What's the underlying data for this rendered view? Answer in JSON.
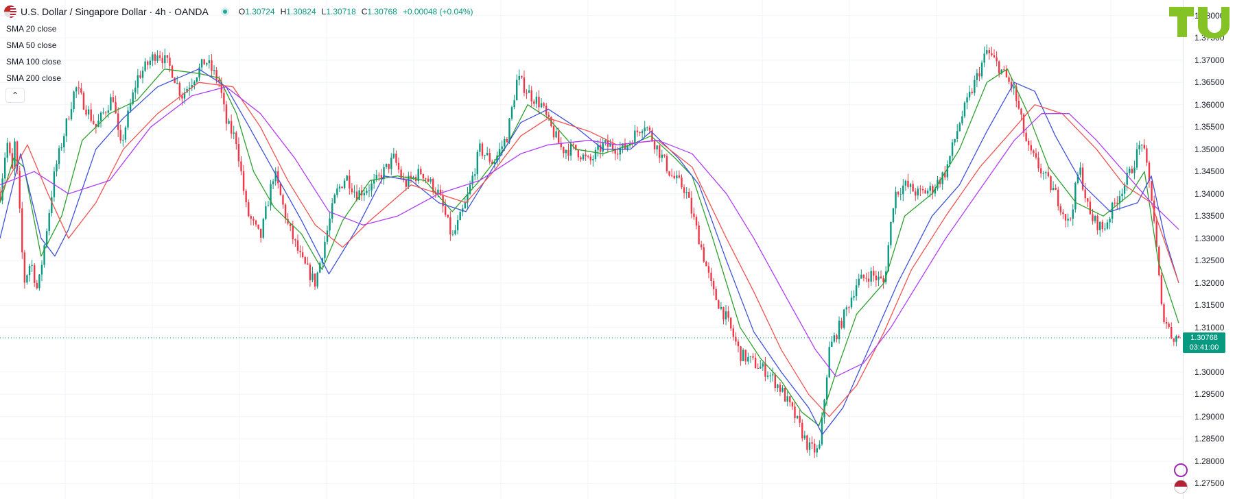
{
  "header": {
    "symbol_title": "U.S. Dollar / Singapore Dollar · 4h · OANDA",
    "o_key": "O",
    "o_val": "1.30724",
    "h_key": "H",
    "h_val": "1.30824",
    "l_key": "L",
    "l_val": "1.30718",
    "c_key": "C",
    "c_val": "1.30768",
    "change": "+0.00048 (+0.04%)"
  },
  "indicators": [
    {
      "label": "SMA",
      "value": "20 close",
      "color": "#2ca02c"
    },
    {
      "label": "SMA",
      "value": "50 close",
      "color": "#3f51d9"
    },
    {
      "label": "SMA",
      "value": "100 close",
      "color": "#ef5350"
    },
    {
      "label": "SMA",
      "value": "200 close",
      "color": "#b03cf5"
    }
  ],
  "price_axis_ticks": [
    "1.38000",
    "1.37500",
    "1.37000",
    "1.36500",
    "1.36000",
    "1.35500",
    "1.35000",
    "1.34500",
    "1.34000",
    "1.33500",
    "1.33000",
    "1.32500",
    "1.32000",
    "1.31500",
    "1.31000",
    "1.30000",
    "1.29500",
    "1.29000",
    "1.28500",
    "1.28000",
    "1.27500"
  ],
  "current_price": {
    "price": "1.30768",
    "countdown": "03:41:00"
  },
  "colors": {
    "up": "#089981",
    "down": "#f23645",
    "grid": "#f0f3fa",
    "accent": "#089981",
    "logo": "#84c225"
  },
  "chart_data": {
    "type": "line",
    "ylim": [
      1.2715,
      1.3835
    ],
    "price_line": 1.30768,
    "candles_n": 480,
    "price_path": [
      [
        0,
        1.34
      ],
      [
        10,
        1.352
      ],
      [
        18,
        1.345
      ],
      [
        22,
        1.352
      ],
      [
        35,
        1.32
      ],
      [
        45,
        1.325
      ],
      [
        55,
        1.318
      ],
      [
        80,
        1.345
      ],
      [
        110,
        1.364
      ],
      [
        140,
        1.355
      ],
      [
        165,
        1.362
      ],
      [
        175,
        1.35
      ],
      [
        200,
        1.366
      ],
      [
        230,
        1.372
      ],
      [
        250,
        1.368
      ],
      [
        265,
        1.362
      ],
      [
        300,
        1.37
      ],
      [
        320,
        1.365
      ],
      [
        330,
        1.356
      ],
      [
        345,
        1.352
      ],
      [
        360,
        1.336
      ],
      [
        380,
        1.33
      ],
      [
        400,
        1.345
      ],
      [
        420,
        1.333
      ],
      [
        440,
        1.325
      ],
      [
        460,
        1.32
      ],
      [
        475,
        1.33
      ],
      [
        490,
        1.34
      ],
      [
        505,
        1.344
      ],
      [
        520,
        1.34
      ],
      [
        545,
        1.342
      ],
      [
        560,
        1.345
      ],
      [
        575,
        1.348
      ],
      [
        590,
        1.342
      ],
      [
        615,
        1.345
      ],
      [
        640,
        1.34
      ],
      [
        660,
        1.33
      ],
      [
        680,
        1.338
      ],
      [
        700,
        1.35
      ],
      [
        720,
        1.347
      ],
      [
        740,
        1.353
      ],
      [
        755,
        1.366
      ],
      [
        775,
        1.362
      ],
      [
        790,
        1.36
      ],
      [
        800,
        1.356
      ],
      [
        820,
        1.35
      ],
      [
        840,
        1.35
      ],
      [
        860,
        1.347
      ],
      [
        880,
        1.351
      ],
      [
        910,
        1.35
      ],
      [
        940,
        1.356
      ],
      [
        960,
        1.35
      ],
      [
        980,
        1.344
      ],
      [
        1000,
        1.341
      ],
      [
        1020,
        1.33
      ],
      [
        1040,
        1.318
      ],
      [
        1060,
        1.312
      ],
      [
        1080,
        1.304
      ],
      [
        1100,
        1.302
      ],
      [
        1120,
        1.3
      ],
      [
        1140,
        1.296
      ],
      [
        1160,
        1.29
      ],
      [
        1180,
        1.283
      ],
      [
        1195,
        1.282
      ],
      [
        1210,
        1.305
      ],
      [
        1230,
        1.312
      ],
      [
        1250,
        1.32
      ],
      [
        1270,
        1.322
      ],
      [
        1290,
        1.32
      ],
      [
        1305,
        1.34
      ],
      [
        1320,
        1.342
      ],
      [
        1340,
        1.34
      ],
      [
        1360,
        1.341
      ],
      [
        1380,
        1.345
      ],
      [
        1400,
        1.356
      ],
      [
        1420,
        1.364
      ],
      [
        1440,
        1.372
      ],
      [
        1460,
        1.368
      ],
      [
        1480,
        1.363
      ],
      [
        1500,
        1.35
      ],
      [
        1520,
        1.345
      ],
      [
        1540,
        1.34
      ],
      [
        1560,
        1.333
      ],
      [
        1575,
        1.346
      ],
      [
        1590,
        1.335
      ],
      [
        1610,
        1.332
      ],
      [
        1630,
        1.339
      ],
      [
        1650,
        1.345
      ],
      [
        1666,
        1.352
      ],
      [
        1682,
        1.338
      ],
      [
        1695,
        1.314
      ],
      [
        1710,
        1.308
      ],
      [
        1720,
        1.3077
      ]
    ],
    "series": [
      {
        "name": "SMA 20 close",
        "color": "#2ca02c",
        "points": [
          [
            0,
            1.338
          ],
          [
            20,
            1.348
          ],
          [
            35,
            1.346
          ],
          [
            60,
            1.326
          ],
          [
            90,
            1.335
          ],
          [
            120,
            1.352
          ],
          [
            160,
            1.358
          ],
          [
            200,
            1.361
          ],
          [
            240,
            1.368
          ],
          [
            290,
            1.367
          ],
          [
            320,
            1.366
          ],
          [
            345,
            1.358
          ],
          [
            370,
            1.345
          ],
          [
            400,
            1.337
          ],
          [
            440,
            1.331
          ],
          [
            470,
            1.323
          ],
          [
            500,
            1.334
          ],
          [
            540,
            1.343
          ],
          [
            580,
            1.344
          ],
          [
            620,
            1.343
          ],
          [
            660,
            1.336
          ],
          [
            700,
            1.343
          ],
          [
            740,
            1.351
          ],
          [
            770,
            1.36
          ],
          [
            800,
            1.357
          ],
          [
            840,
            1.35
          ],
          [
            880,
            1.349
          ],
          [
            920,
            1.351
          ],
          [
            950,
            1.353
          ],
          [
            985,
            1.348
          ],
          [
            1010,
            1.344
          ],
          [
            1040,
            1.33
          ],
          [
            1080,
            1.31
          ],
          [
            1110,
            1.303
          ],
          [
            1140,
            1.298
          ],
          [
            1170,
            1.291
          ],
          [
            1195,
            1.288
          ],
          [
            1220,
            1.3
          ],
          [
            1250,
            1.313
          ],
          [
            1290,
            1.32
          ],
          [
            1320,
            1.335
          ],
          [
            1360,
            1.34
          ],
          [
            1400,
            1.35
          ],
          [
            1440,
            1.365
          ],
          [
            1470,
            1.368
          ],
          [
            1500,
            1.358
          ],
          [
            1530,
            1.346
          ],
          [
            1570,
            1.338
          ],
          [
            1610,
            1.335
          ],
          [
            1650,
            1.34
          ],
          [
            1670,
            1.345
          ],
          [
            1690,
            1.325
          ],
          [
            1720,
            1.311
          ]
        ]
      },
      {
        "name": "SMA 50 close",
        "color": "#3f51d9",
        "points": [
          [
            0,
            1.33
          ],
          [
            30,
            1.349
          ],
          [
            60,
            1.33
          ],
          [
            80,
            1.326
          ],
          [
            100,
            1.332
          ],
          [
            140,
            1.35
          ],
          [
            180,
            1.357
          ],
          [
            230,
            1.364
          ],
          [
            290,
            1.368
          ],
          [
            330,
            1.364
          ],
          [
            360,
            1.356
          ],
          [
            400,
            1.345
          ],
          [
            440,
            1.334
          ],
          [
            480,
            1.322
          ],
          [
            520,
            1.332
          ],
          [
            560,
            1.344
          ],
          [
            600,
            1.343
          ],
          [
            640,
            1.338
          ],
          [
            680,
            1.336
          ],
          [
            720,
            1.346
          ],
          [
            760,
            1.356
          ],
          [
            800,
            1.359
          ],
          [
            840,
            1.355
          ],
          [
            880,
            1.35
          ],
          [
            920,
            1.35
          ],
          [
            950,
            1.354
          ],
          [
            990,
            1.348
          ],
          [
            1020,
            1.342
          ],
          [
            1060,
            1.325
          ],
          [
            1100,
            1.309
          ],
          [
            1140,
            1.3
          ],
          [
            1180,
            1.292
          ],
          [
            1200,
            1.286
          ],
          [
            1230,
            1.292
          ],
          [
            1270,
            1.306
          ],
          [
            1310,
            1.32
          ],
          [
            1360,
            1.335
          ],
          [
            1400,
            1.342
          ],
          [
            1440,
            1.354
          ],
          [
            1480,
            1.365
          ],
          [
            1510,
            1.363
          ],
          [
            1540,
            1.353
          ],
          [
            1580,
            1.342
          ],
          [
            1620,
            1.336
          ],
          [
            1660,
            1.338
          ],
          [
            1680,
            1.344
          ],
          [
            1700,
            1.33
          ],
          [
            1720,
            1.32
          ]
        ]
      },
      {
        "name": "SMA 100 close",
        "color": "#ef5350",
        "points": [
          [
            0,
            1.34
          ],
          [
            40,
            1.351
          ],
          [
            70,
            1.34
          ],
          [
            100,
            1.33
          ],
          [
            140,
            1.338
          ],
          [
            180,
            1.35
          ],
          [
            230,
            1.358
          ],
          [
            290,
            1.365
          ],
          [
            340,
            1.364
          ],
          [
            380,
            1.355
          ],
          [
            420,
            1.343
          ],
          [
            460,
            1.333
          ],
          [
            500,
            1.328
          ],
          [
            540,
            1.334
          ],
          [
            600,
            1.342
          ],
          [
            640,
            1.34
          ],
          [
            680,
            1.338
          ],
          [
            720,
            1.345
          ],
          [
            760,
            1.353
          ],
          [
            800,
            1.357
          ],
          [
            860,
            1.354
          ],
          [
            900,
            1.351
          ],
          [
            960,
            1.352
          ],
          [
            1010,
            1.346
          ],
          [
            1060,
            1.33
          ],
          [
            1100,
            1.318
          ],
          [
            1140,
            1.305
          ],
          [
            1180,
            1.295
          ],
          [
            1210,
            1.29
          ],
          [
            1250,
            1.297
          ],
          [
            1290,
            1.309
          ],
          [
            1330,
            1.323
          ],
          [
            1380,
            1.335
          ],
          [
            1430,
            1.346
          ],
          [
            1470,
            1.353
          ],
          [
            1510,
            1.36
          ],
          [
            1550,
            1.358
          ],
          [
            1600,
            1.35
          ],
          [
            1640,
            1.342
          ],
          [
            1680,
            1.338
          ],
          [
            1720,
            1.32
          ]
        ]
      },
      {
        "name": "SMA 200 close",
        "color": "#b03cf5",
        "points": [
          [
            0,
            1.342
          ],
          [
            50,
            1.345
          ],
          [
            100,
            1.34
          ],
          [
            160,
            1.343
          ],
          [
            220,
            1.355
          ],
          [
            280,
            1.362
          ],
          [
            330,
            1.364
          ],
          [
            380,
            1.358
          ],
          [
            430,
            1.348
          ],
          [
            480,
            1.336
          ],
          [
            530,
            1.333
          ],
          [
            580,
            1.335
          ],
          [
            640,
            1.34
          ],
          [
            700,
            1.343
          ],
          [
            760,
            1.349
          ],
          [
            800,
            1.351
          ],
          [
            860,
            1.352
          ],
          [
            900,
            1.351
          ],
          [
            960,
            1.352
          ],
          [
            1010,
            1.349
          ],
          [
            1060,
            1.34
          ],
          [
            1100,
            1.33
          ],
          [
            1150,
            1.316
          ],
          [
            1190,
            1.305
          ],
          [
            1220,
            1.299
          ],
          [
            1260,
            1.302
          ],
          [
            1300,
            1.31
          ],
          [
            1340,
            1.32
          ],
          [
            1380,
            1.33
          ],
          [
            1430,
            1.341
          ],
          [
            1480,
            1.352
          ],
          [
            1520,
            1.358
          ],
          [
            1560,
            1.358
          ],
          [
            1600,
            1.352
          ],
          [
            1640,
            1.345
          ],
          [
            1680,
            1.338
          ],
          [
            1720,
            1.332
          ]
        ]
      }
    ]
  }
}
